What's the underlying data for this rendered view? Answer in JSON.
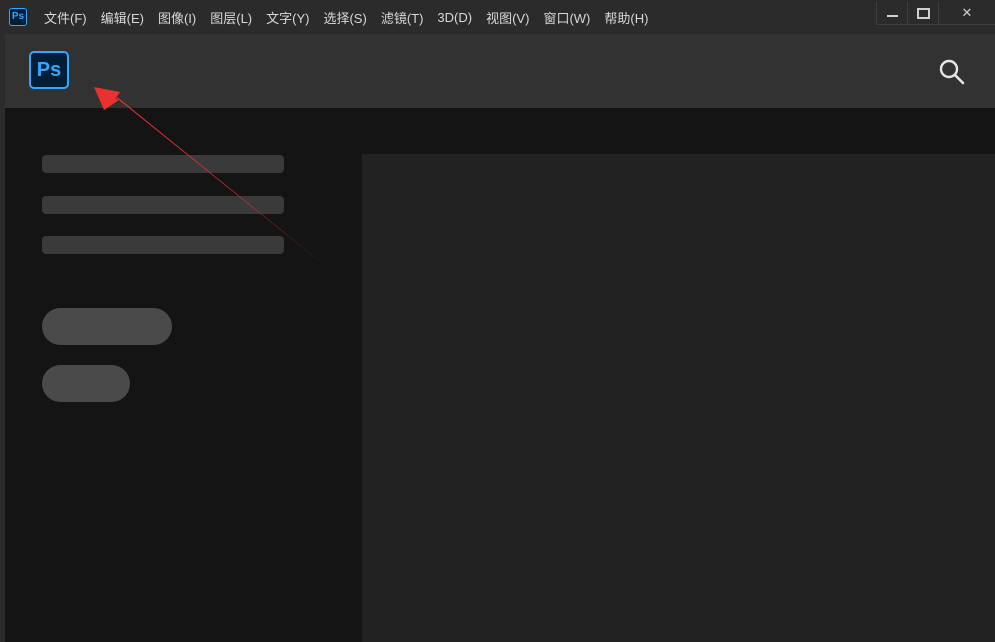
{
  "titlebar": {
    "app_icon_text": "Ps",
    "menu": [
      {
        "label": "文件(F)"
      },
      {
        "label": "编辑(E)"
      },
      {
        "label": "图像(I)"
      },
      {
        "label": "图层(L)"
      },
      {
        "label": "文字(Y)"
      },
      {
        "label": "选择(S)"
      },
      {
        "label": "滤镜(T)"
      },
      {
        "label": "3D(D)"
      },
      {
        "label": "视图(V)"
      },
      {
        "label": "窗口(W)"
      },
      {
        "label": "帮助(H)"
      }
    ],
    "controls": {
      "close_glyph": "✕"
    }
  },
  "header": {
    "logo_text": "Ps",
    "logo_icon": "photoshop-logo-icon",
    "search_icon": "search-icon"
  },
  "colors": {
    "brand": "#31a8ff",
    "annotation_arrow": "#e8322f",
    "background": "#141414",
    "header": "#323232",
    "content_panel": "#222222"
  }
}
